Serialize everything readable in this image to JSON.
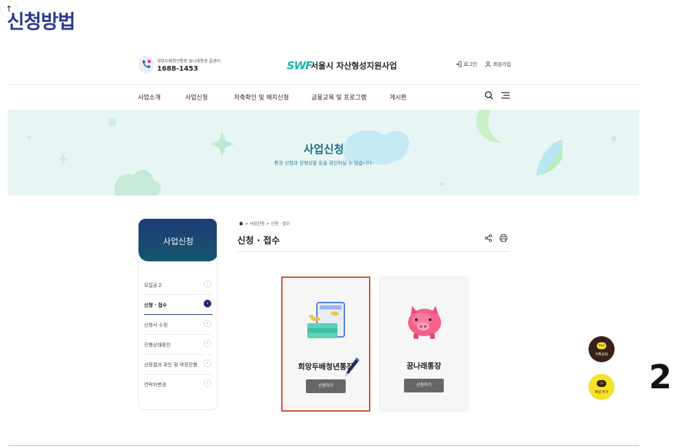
{
  "heading": "신청방법",
  "step_number": "2",
  "header": {
    "callcenter_label": "희망두배청년통장·꿈나래통장 콜센터",
    "callcenter_number": "1688-1453",
    "brand_logo": "SWF",
    "brand_name": "서울시 자산형성지원사업",
    "login_label": "로그인",
    "signup_label": "회원가입"
  },
  "nav": {
    "items": [
      "사업소개",
      "사업신청",
      "저축확인 및 해지신청",
      "금융교육 및 프로그램",
      "게시판"
    ]
  },
  "banner": {
    "title": "사업신청",
    "subtitle": "통장 신청과 진행상황 등을 확인하실 수 있습니다."
  },
  "sidebar": {
    "title": "사업신청",
    "items": [
      {
        "label": "모집공고"
      },
      {
        "label": "신청 · 접수"
      },
      {
        "label": "신청서 수정"
      },
      {
        "label": "진행상태확인"
      },
      {
        "label": "선정결과 확인 및 약정진행"
      },
      {
        "label": "연락처변경"
      }
    ],
    "active_index": 1,
    "chevron_glyph": "›"
  },
  "content": {
    "breadcrumb": {
      "home_icon": "home-icon",
      "separator": ">",
      "items": [
        "사업신청",
        "신청 · 접수"
      ]
    },
    "title": "신청 · 접수",
    "cards": [
      {
        "name": "희망두배청년통장",
        "button_label": "신청하기",
        "selected": true,
        "icon": "bankbook-money-icon"
      },
      {
        "name": "꿈나래통장",
        "button_label": "신청하기",
        "selected": false,
        "icon": "piggy-bank-icon"
      }
    ]
  },
  "floating": {
    "talk_badge": "TALK",
    "talk_label": "카톡상담",
    "channel_badge": "Ch",
    "channel_label": "채널 추가",
    "top_glyph": "↑"
  },
  "colors": {
    "heading": "#2a3a8c",
    "brand": "#18b6a8",
    "banner_bg": "#e7f6f5",
    "sidebar_head": "#1d3c78",
    "selection_border": "#c9502f",
    "card_button": "#666666"
  }
}
